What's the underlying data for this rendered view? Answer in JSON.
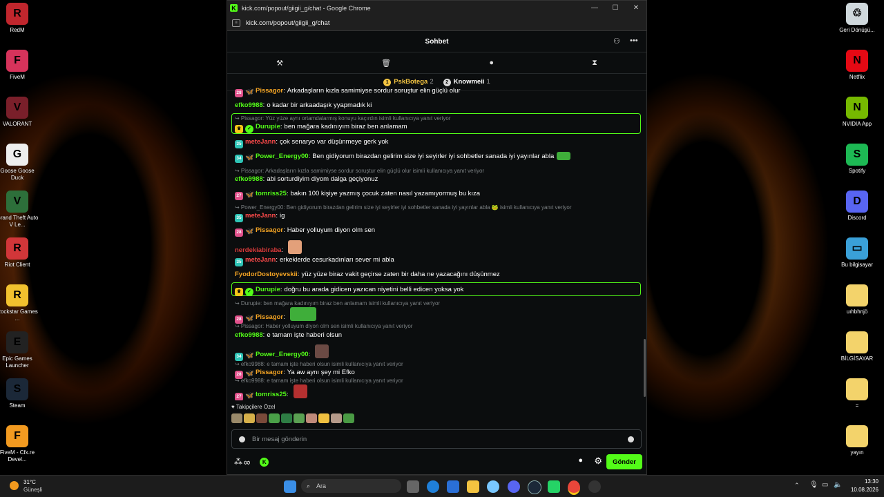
{
  "window": {
    "title": "kick.com/popout/giigii_g/chat - Google Chrome",
    "url": "kick.com/popout/giigii_g/chat",
    "min": "—",
    "max": "☐",
    "close": "✕"
  },
  "chat": {
    "header": "Sohbet",
    "pinned": [
      {
        "rank": "1",
        "name": "PskBotega",
        "count": "2"
      },
      {
        "rank": "2",
        "name": "Knowmeii",
        "count": "1"
      }
    ],
    "subs_label": "Takipçilere Özel",
    "input_placeholder": "Bir mesaj gönderin",
    "send_label": "Gönder",
    "infinity": "∞"
  },
  "messages": [
    {
      "kind": "msg",
      "badge": "28",
      "badge_color": "#e0508a",
      "bfly": "#f5a524",
      "user": "Pissagor",
      "color": "#f5a524",
      "text": "Arkadaşların kızla samimiyse sordur soruştur elin güçlü olur"
    },
    {
      "kind": "msg",
      "user": "efko9988",
      "color": "#53fc18",
      "text": "o kadar bir arkaadaşık yyapmadık ki"
    },
    {
      "kind": "reply",
      "text": "Pissagor: Yüz yüze aynı ortamdalarmış konuyu kaçırdın isimli kullanıcıya yanıt veriyor"
    },
    {
      "kind": "msg",
      "crown": true,
      "verified": true,
      "user": "Durupie",
      "color": "#53fc18",
      "text": "ben mağara kadınıyım biraz ben anlamam",
      "highlight": true
    },
    {
      "kind": "msg",
      "badge": "35",
      "badge_color": "#2ec4b6",
      "user": "meteJann",
      "color": "#ff4b4b",
      "text": "çok senaryo var düşünmeye gerk yok"
    },
    {
      "kind": "msg",
      "badge": "34",
      "badge_color": "#2ec4b6",
      "bfly": "#f5d524",
      "user": "Power_Energy00",
      "color": "#53fc18",
      "text": "Ben gidiyorum birazdan gelirim size iyi seyirler iyi sohbetler sanada iyi yayınlar abla",
      "emote": "#3fae3a"
    },
    {
      "kind": "reply",
      "text": "Pissagor: Arkadaşların kızla samimiyse sordur soruştur elin güçlü olur isimli kullanıcıya yanıt veriyor"
    },
    {
      "kind": "msg",
      "user": "efko9988",
      "color": "#53fc18",
      "text": "abi sorturdiyim diyom dalga geçiyonuz"
    },
    {
      "kind": "msg",
      "badge": "27",
      "badge_color": "#e0508a",
      "bfly": "#53fc18",
      "user": "tomriss25",
      "color": "#53fc18",
      "text": "bakın 100 kişiye yazmış çocuk zaten nasıl yazamıyormuş bu kıza"
    },
    {
      "kind": "reply",
      "text": "Power_Energy00: Ben gidiyorum birazdan gelirim size iyi seyirler iyi sohbetler sanada iyi yayınlar abla 🐸 isimli kullanıcıya yanıt veriyor"
    },
    {
      "kind": "msg",
      "badge": "35",
      "badge_color": "#2ec4b6",
      "user": "meteJann",
      "color": "#ff4b4b",
      "text": "ig"
    },
    {
      "kind": "msg",
      "badge": "28",
      "badge_color": "#e0508a",
      "bfly": "#f5a524",
      "user": "Pissagor",
      "color": "#f5a524",
      "text": "Haber yolluyum diyon olm sen"
    },
    {
      "kind": "msg",
      "user": "nerdekiabiraba",
      "color": "#d93a3a",
      "text": "",
      "emote": "#e3a07a"
    },
    {
      "kind": "msg",
      "badge": "35",
      "badge_color": "#2ec4b6",
      "user": "meteJann",
      "color": "#ff4b4b",
      "text": "erkeklerde cesurkadınları sever mi abla"
    },
    {
      "kind": "msg",
      "user": "FyodorDostoyevskii",
      "color": "#f5a524",
      "text": "yüz yüze biraz vakit geçirse zaten bir daha ne yazacağını düşünmez"
    },
    {
      "kind": "msg",
      "crown": true,
      "verified": true,
      "user": "Durupie",
      "color": "#53fc18",
      "text": "doğru bu arada gidicen yazıcan niyetini belli edicen yoksa yok",
      "highlight": true
    },
    {
      "kind": "reply",
      "text": "Durupie: ben mağara kadınıyım biraz ben anlamam isimli kullanıcıya yanıt veriyor"
    },
    {
      "kind": "msg",
      "badge": "28",
      "badge_color": "#e0508a",
      "bfly": "#f5a524",
      "user": "Pissagor",
      "color": "#f5a524",
      "text": "",
      "emote": "#3fae3a",
      "wide": true
    },
    {
      "kind": "reply",
      "text": "Pissagor: Haber yolluyum diyon olm sen isimli kullanıcıya yanıt veriyor"
    },
    {
      "kind": "msg",
      "user": "efko9988",
      "color": "#53fc18",
      "text": "e tamam işte haberi olsun"
    },
    {
      "kind": "msg",
      "badge": "34",
      "badge_color": "#2ec4b6",
      "bfly": "#f5d524",
      "user": "Power_Energy00",
      "color": "#53fc18",
      "text": "",
      "emote": "#6b4a44"
    },
    {
      "kind": "reply",
      "text": "efko9988: e tamam işte haberi olsun isimli kullanıcıya yanıt veriyor"
    },
    {
      "kind": "msg",
      "badge": "28",
      "badge_color": "#e0508a",
      "bfly": "#f5a524",
      "user": "Pissagor",
      "color": "#f5a524",
      "text": "Ya aw aynı şey mi Efko"
    },
    {
      "kind": "reply",
      "text": "efko9988: e tamam işte haberi olsun isimli kullanıcıya yanıt veriyor"
    },
    {
      "kind": "msg",
      "badge": "27",
      "badge_color": "#e0508a",
      "bfly": "#53fc18",
      "user": "tomriss25",
      "color": "#53fc18",
      "text": "",
      "emote": "#b53030"
    }
  ],
  "desktop_left": [
    {
      "label": "RedM",
      "color": "#c0262d",
      "glyph": "R"
    },
    {
      "label": "FiveM",
      "color": "#d6335b",
      "glyph": "F"
    },
    {
      "label": "VALORANT",
      "color": "#7a1f2a",
      "glyph": "V"
    },
    {
      "label": "Goose Goose Duck",
      "color": "#eeeeee",
      "glyph": "G"
    },
    {
      "label": "Grand Theft Auto V Le...",
      "color": "#2d6f3a",
      "glyph": "V"
    },
    {
      "label": "Riot Client",
      "color": "#d13639",
      "glyph": "R"
    },
    {
      "label": "Rockstar Games ...",
      "color": "#f2c12e",
      "glyph": "R"
    },
    {
      "label": "Epic Games Launcher",
      "color": "#222222",
      "glyph": "E"
    },
    {
      "label": "Steam",
      "color": "#1b2838",
      "glyph": "S"
    },
    {
      "label": "FiveM - Cfx.re Devel...",
      "color": "#f29a20",
      "glyph": "F"
    }
  ],
  "desktop_right": [
    {
      "label": "Geri Dönüşü...",
      "color": "#cfd8dc",
      "glyph": "♲"
    },
    {
      "label": "Netflix",
      "color": "#e50914",
      "glyph": "N"
    },
    {
      "label": "NVIDIA App",
      "color": "#76b900",
      "glyph": "N"
    },
    {
      "label": "Spotify",
      "color": "#1db954",
      "glyph": "S"
    },
    {
      "label": "Discord",
      "color": "#5865f2",
      "glyph": "D"
    },
    {
      "label": "Bu bilgisayar",
      "color": "#3aa0d8",
      "glyph": "▭"
    },
    {
      "label": "uıhbhnjö",
      "color": "#f3d36b",
      "glyph": ""
    },
    {
      "label": "BİLGİSAYAR",
      "color": "#f3d36b",
      "glyph": ""
    },
    {
      "label": "=",
      "color": "#f3d36b",
      "glyph": ""
    },
    {
      "label": "yayın",
      "color": "#f3d36b",
      "glyph": ""
    }
  ],
  "taskbar": {
    "weather_temp": "31°C",
    "weather_desc": "Güneşli",
    "search": "Ara",
    "time": "13:30",
    "date": "10.08.2026"
  }
}
